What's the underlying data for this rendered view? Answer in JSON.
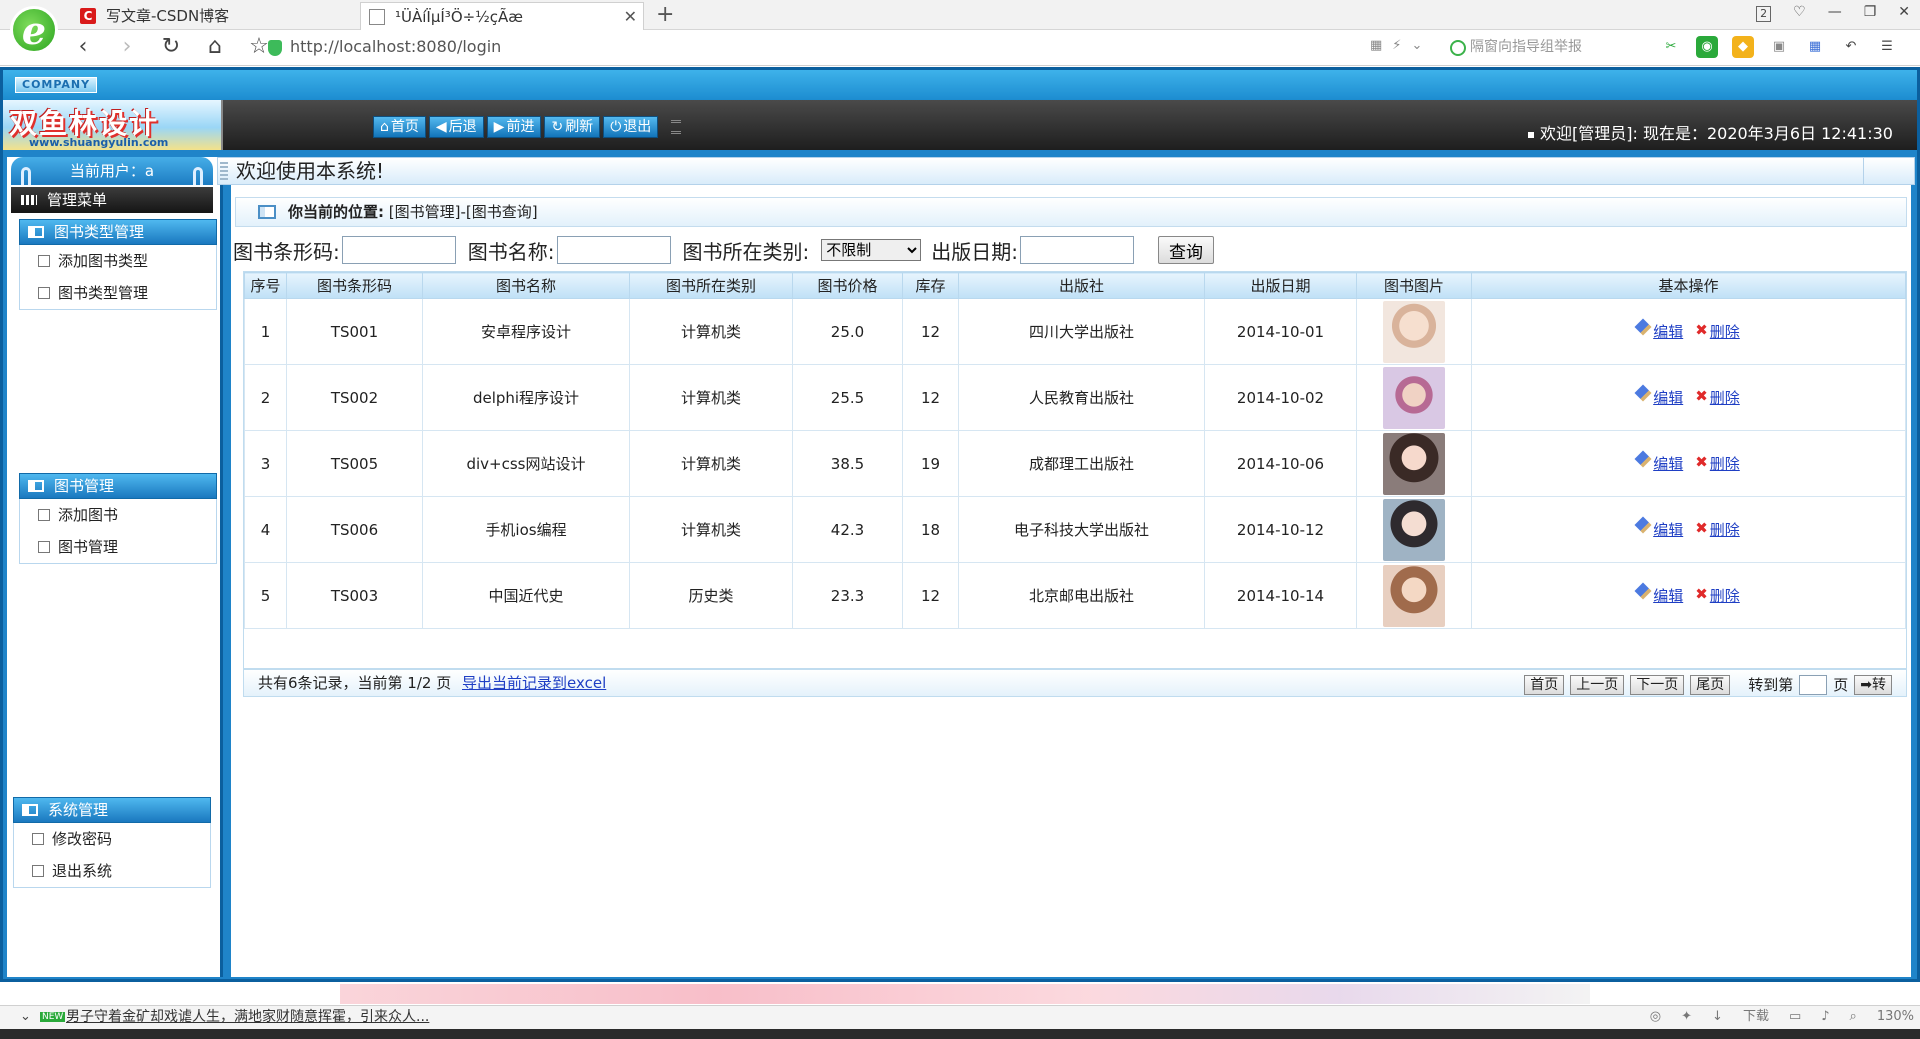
{
  "browser": {
    "tabs": [
      {
        "title": "写文章-CSDN博客",
        "favicon": "csdn-icon"
      },
      {
        "title": "¹ÜÀíÏµÍ³Ö÷½çÃæ",
        "favicon": "doc-icon"
      }
    ],
    "new_tab": "+",
    "window_badge": "2",
    "url": "http://localhost:8080/login",
    "search_placeholder": "隔窗向指导组举报",
    "zoom": "130%",
    "download_label": "下载"
  },
  "app": {
    "company_label": "COMPANY",
    "logo_title": "双鱼林设计",
    "logo_url": "www.shuangyulin.com",
    "nav_buttons": [
      "首页",
      "后退",
      "前进",
      "刷新",
      "退出"
    ],
    "welcome_text": "欢迎[管理员]:  现在是：2020年3月6日 12:41:30"
  },
  "sidebar": {
    "current_user": "当前用户：a",
    "menu_title": "管理菜单",
    "sections": [
      {
        "title": "图书类型管理",
        "items": [
          "添加图书类型",
          "图书类型管理"
        ]
      },
      {
        "title": "图书管理",
        "items": [
          "添加图书",
          "图书管理"
        ]
      },
      {
        "title": "系统管理",
        "items": [
          "修改密码",
          "退出系统"
        ]
      }
    ]
  },
  "main": {
    "title": "欢迎使用本系统!",
    "location_label": "你当前的位置:",
    "location_path": "[图书管理]-[图书查询]",
    "search": {
      "barcode_label": "图书条形码:",
      "name_label": "图书名称:",
      "category_label": "图书所在类别:",
      "category_value": "不限制",
      "date_label": "出版日期:",
      "query_button": "查询"
    },
    "table": {
      "headers": [
        "序号",
        "图书条形码",
        "图书名称",
        "图书所在类别",
        "图书价格",
        "库存",
        "出版社",
        "出版日期",
        "图书图片",
        "基本操作"
      ],
      "edit_label": "编辑",
      "delete_label": "删除",
      "rows": [
        [
          "1",
          "TS001",
          "安卓程序设计",
          "计算机类",
          "25.0",
          "12",
          "四川大学出版社",
          "2014-10-01"
        ],
        [
          "2",
          "TS002",
          "delphi程序设计",
          "计算机类",
          "25.5",
          "12",
          "人民教育出版社",
          "2014-10-02"
        ],
        [
          "3",
          "TS005",
          "div+css网站设计",
          "计算机类",
          "38.5",
          "19",
          "成都理工出版社",
          "2014-10-06"
        ],
        [
          "4",
          "TS006",
          "手机ios编程",
          "计算机类",
          "42.3",
          "18",
          "电子科技大学出版社",
          "2014-10-12"
        ],
        [
          "5",
          "TS003",
          "中国近代史",
          "历史类",
          "23.3",
          "12",
          "北京邮电出版社",
          "2014-10-14"
        ]
      ]
    },
    "pager": {
      "summary": "共有6条记录，当前第 1/2 页",
      "export_link": "导出当前记录到excel",
      "first": "首页",
      "prev": "上一页",
      "next": "下一页",
      "last": "尾页",
      "goto_label": "转到第",
      "page_label": "页",
      "go_button": "转"
    }
  },
  "statusbar": {
    "news_badge": "NEW",
    "news_text": "男子守着金矿却戏谑人生，满地家财随意挥霍，引来众人..."
  }
}
